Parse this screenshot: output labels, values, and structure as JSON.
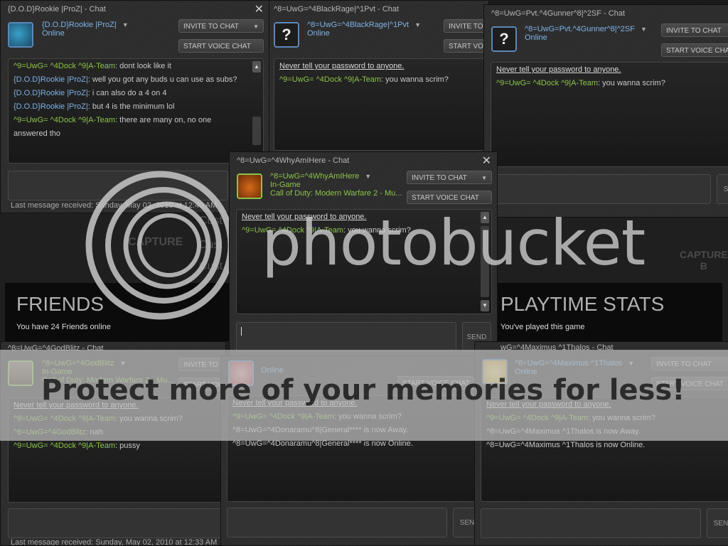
{
  "common": {
    "invite_label": "INVITE TO CHAT",
    "invite_label_truncated": "INVITE TO",
    "voice_label": "START VOICE CHAT",
    "voice_label_truncated": "START VOI",
    "voice_label_truncated2": "START VOICE CHA",
    "send_label": "SEND",
    "send_label_truncated": "SEN",
    "warning": "Never tell your password to anyone.",
    "self_name": "^9=UwG= ^4Dock ^9|A-Team",
    "unknown_avatar": "?",
    "dropdown_caret": "▼",
    "close_glyph": "✕",
    "up_glyph": "▲",
    "down_glyph": "▼"
  },
  "windows": [
    {
      "id": "rookie",
      "title": "{D.O.D}Rookie |ProZ| - Chat",
      "user": "{D.O.D}Rookie |ProZ|",
      "status": "Online",
      "messages": [
        {
          "sender": "^9=UwG= ^4Dock ^9|A-Team",
          "text": ": dont look like it"
        },
        {
          "sender": "{D.O.D}Rookie |ProZ|",
          "text": ": well you got any buds u can use as subs?"
        },
        {
          "sender": "{D.O.D}Rookie |ProZ|",
          "text": ": i can also do a 4 on 4"
        },
        {
          "sender": "{D.O.D}Rookie |ProZ|",
          "text": ": but 4 is the minimum lol"
        },
        {
          "sender": "^9=UwG= ^4Dock ^9|A-Team",
          "text": ": there are many on, no one"
        },
        {
          "sender": "",
          "text": "answered tho"
        }
      ],
      "last_message": "Last message received: Sunday, May 02, 2010 at 12:40 AM"
    },
    {
      "id": "blackrage",
      "title": "^8=UwG=^4BlackRage|^1Pvt - Chat",
      "user": "^8=UwG=^4BlackRage|^1Pvt",
      "status": "Online",
      "messages": [
        {
          "sender": "^9=UwG= ^4Dock ^9|A-Team",
          "text": ": you wanna scrim?"
        }
      ]
    },
    {
      "id": "gunner",
      "title": "^8=UwG=Pvt.^4Gunner^8|^2SF - Chat",
      "user": "^8=UwG=Pvt.^4Gunner^8|^2SF",
      "status": "Online",
      "messages": [
        {
          "sender": "^9=UwG= ^4Dock ^9|A-Team",
          "text": ": you wanna scrim?"
        }
      ]
    },
    {
      "id": "whyamihere",
      "title": "^8=UwG=^4WhyAmIHere - Chat",
      "user": "^8=UwG=^4WhyAmIHere",
      "status": "In-Game",
      "game": "Call of Duty: Modern Warfare 2 - Mu...",
      "messages": [
        {
          "sender": "^9=UwG= ^4Dock ^9|A-Team",
          "text": ": you wanna scrim?"
        }
      ]
    },
    {
      "id": "godblitz",
      "title": "^8=UwG=^4GodBlitz - Chat",
      "user": "^8=UwG=^4GodBlitz",
      "status": "In-Game",
      "game": "Call of Duty: Modern Warfare 2 - Mu...",
      "messages": [
        {
          "sender": "^9=UwG= ^4Dock ^9|A-Team",
          "text": ": you wanna scrim?"
        },
        {
          "sender": "^8=UwG=^4GodBlitz",
          "text": ": nah"
        },
        {
          "sender": "^9=UwG= ^4Dock ^9|A-Team",
          "text": ": pussy"
        }
      ],
      "last_message": "Last message received: Sunday, May 02, 2010 at 12:33 AM"
    },
    {
      "id": "donaramu",
      "status": "Online",
      "messages": [
        {
          "sender": "^9=UwG= ^4Dock ^9|A-Team",
          "text": ": you wanna scrim?"
        },
        {
          "sender": "",
          "text": "^8=UwG=^4Donaramu^8|General**** is now Away."
        },
        {
          "sender": "",
          "text": "^8=UwG=^4Donaramu^8|General**** is now Online."
        }
      ]
    },
    {
      "id": "maximus",
      "title": "wG=^4Maximus ^1Thalos - Chat",
      "user": "^8=UwG=^4Maximus ^1Thalos",
      "status": "Online",
      "messages": [
        {
          "sender": "^9=UwG= ^4Dock ^9|A-Team",
          "text": ": you wanna scrim?"
        },
        {
          "sender": "",
          "text": "^8=UwG=^4Maximus ^1Thalos is now Away."
        },
        {
          "sender": "",
          "text": "^8=UwG=^4Maximus ^1Thalos is now Online."
        }
      ]
    }
  ],
  "background": {
    "friends_title": "FRIENDS",
    "friends_sub": "You have 24 Friends online",
    "playtime_title": "PLAYTIME STATS",
    "playtime_sub": "You've played this game",
    "capture_label": "CAPTURE",
    "capture_b": "B",
    "cust_1": "Cust",
    "cust_2": "Cust",
    "cust_3": "Cust"
  },
  "watermark": {
    "logo_text": "photobucket",
    "banner": "Protect more of your memories for less!"
  }
}
